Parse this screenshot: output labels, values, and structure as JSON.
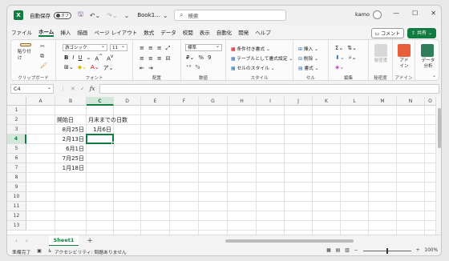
{
  "titlebar": {
    "autosave_label": "自動保存",
    "autosave_state": "オフ",
    "title": "Book1...",
    "search_placeholder": "検索",
    "user": "kamo"
  },
  "tabs": [
    "ファイル",
    "ホーム",
    "挿入",
    "描画",
    "ページ レイアウト",
    "数式",
    "データ",
    "校閲",
    "表示",
    "自動化",
    "開発",
    "ヘルプ"
  ],
  "active_tab": "ホーム",
  "tab_actions": {
    "comment": "コメント",
    "share": "共有"
  },
  "ribbon": {
    "clipboard": {
      "paste": "貼り付け",
      "label": "クリップボード"
    },
    "font": {
      "name": "游ゴシック",
      "size": "11",
      "label": "フォント"
    },
    "alignment": {
      "label": "配置"
    },
    "number": {
      "format": "標準",
      "label": "数値"
    },
    "styles": {
      "conditional": "条件付き書式",
      "table": "テーブルとして書式設定",
      "cell_styles": "セルのスタイル",
      "label": "スタイル"
    },
    "cells": {
      "insert": "挿入",
      "delete": "削除",
      "format": "書式",
      "label": "セル"
    },
    "editing": {
      "label": "編集"
    },
    "sensitivity": {
      "btn": "秘密度",
      "label": "秘密度"
    },
    "addins": {
      "btn": "アド\nイン",
      "label": "アドイン"
    },
    "analysis": {
      "btn": "データ\n分析"
    }
  },
  "formula_bar": {
    "name_box": "C4",
    "fx": "fx",
    "value": ""
  },
  "columns": [
    "A",
    "B",
    "C",
    "D",
    "E",
    "F",
    "G",
    "H",
    "I",
    "J",
    "K",
    "L",
    "M",
    "N",
    "O"
  ],
  "rows": [
    "1",
    "2",
    "3",
    "4",
    "5",
    "6",
    "7",
    "8",
    "9",
    "10",
    "11",
    "12",
    "13"
  ],
  "cells": {
    "B2": "開始日",
    "C2": "月末までの日数",
    "B3": "8月25日",
    "C3": "1月6日",
    "B4": "2月13日",
    "B5": "6月1日",
    "B6": "7月25日",
    "B7": "1月18日"
  },
  "selected_cell": "C4",
  "sheets": [
    "Sheet1"
  ],
  "status": {
    "ready": "準備完了",
    "accessibility": "アクセシビリティ: 問題ありません",
    "zoom": "100%"
  }
}
